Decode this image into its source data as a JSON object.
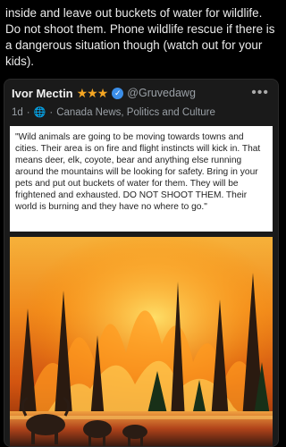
{
  "intro_text": "inside and leave out buckets of water for wildlife. Do not shoot them. Phone wildlife rescue if there is a dangerous situation though (watch out for your kids).",
  "post": {
    "author": "Ivor Mectin",
    "badges": "★★★",
    "verified_icon": "check-circle-icon",
    "handle": "@Gruvedawg",
    "time": "1d",
    "audience_icon": "globe-icon",
    "group": "Canada News, Politics and Culture",
    "more_icon": "more-dots-icon",
    "quote": "\"Wild animals are going to be moving towards towns and cities. Their area is on fire and flight instincts will kick in. That means deer, elk, coyote, bear and anything else running around the mountains will be looking for safety. Bring in your pets and put out buckets of water for them. They will be frightened and exhausted. DO NOT SHOOT THEM. Their world is burning and they have no where to go.\""
  },
  "colors": {
    "background": "#000000",
    "card": "#1a1a1a",
    "star": "#f5a623",
    "verified": "#3b8ee8",
    "muted": "#9aa0a6"
  }
}
